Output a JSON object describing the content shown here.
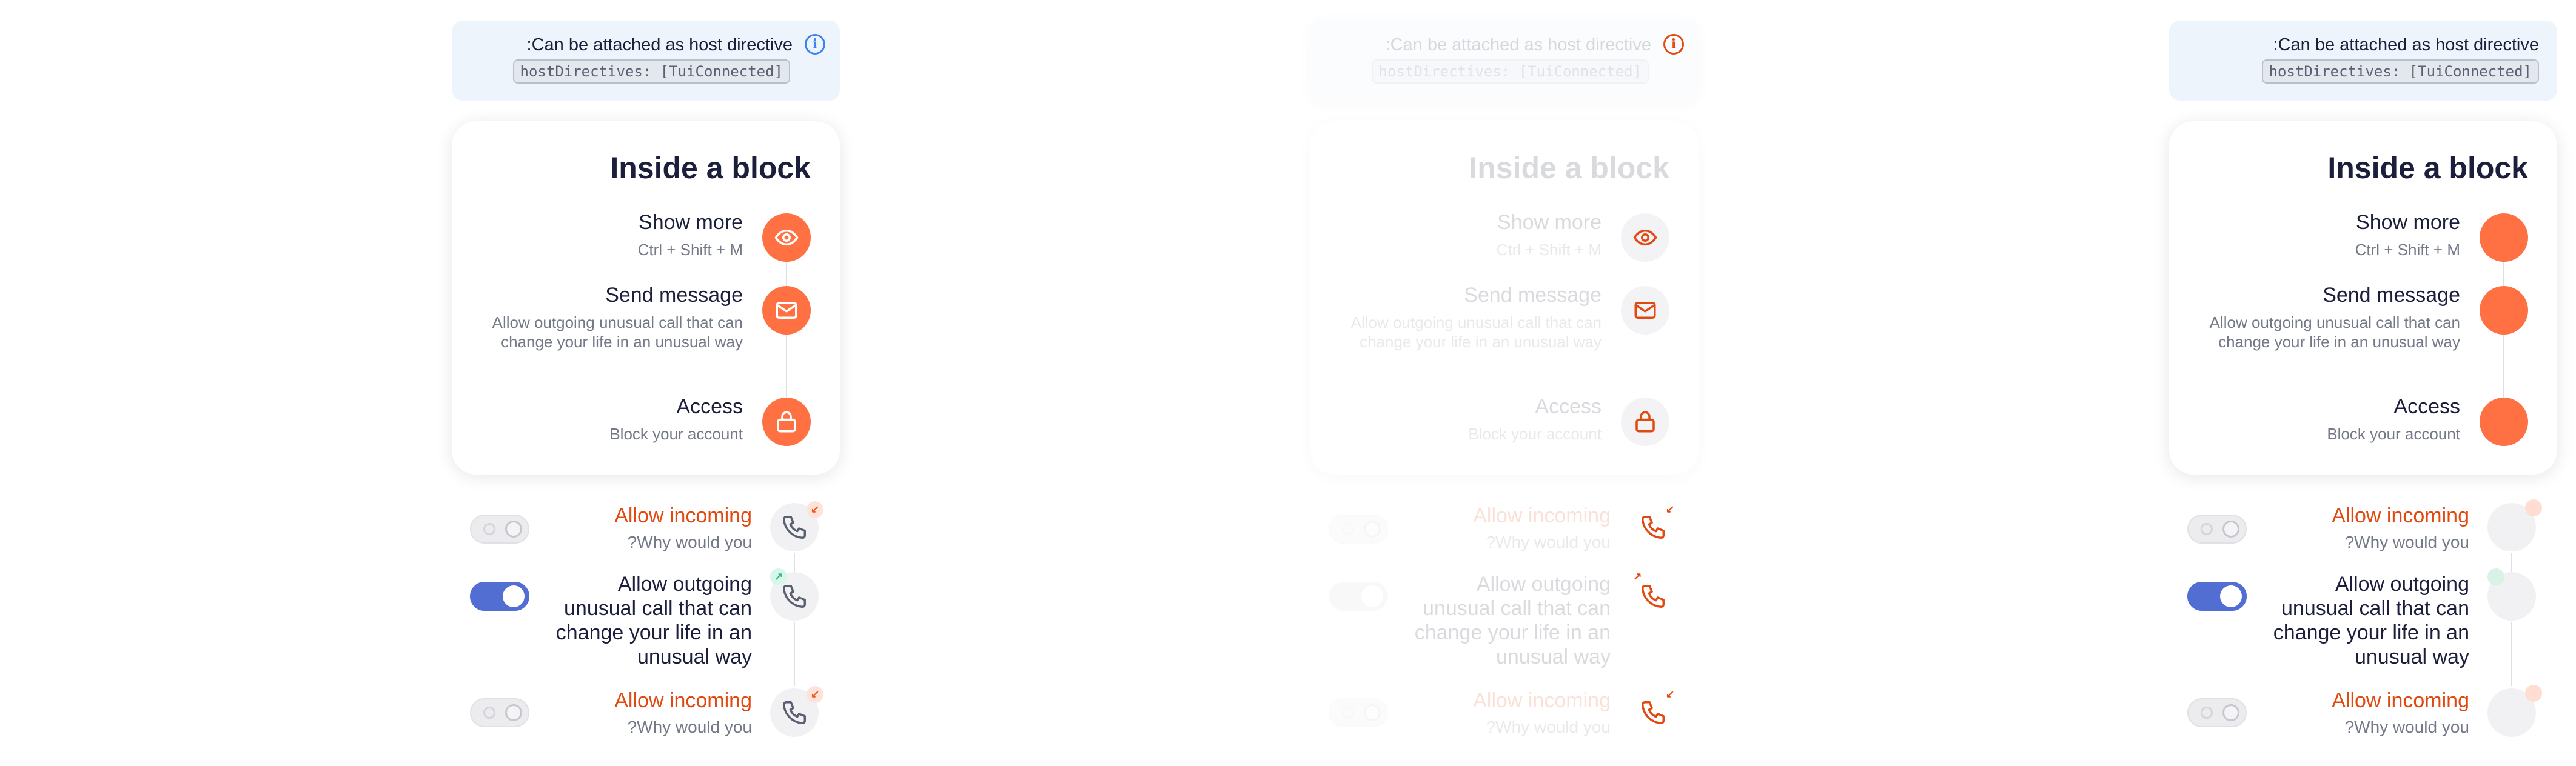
{
  "note": {
    "text": ":Can be attached as host directive",
    "code": "hostDirectives: [TuiConnected]",
    "icon": "info-icon"
  },
  "block": {
    "title": "Inside a block",
    "items": [
      {
        "title": "Show more",
        "desc": "Ctrl + Shift + M",
        "icon": "eye-icon"
      },
      {
        "title": "Send message",
        "desc": "Allow outgoing unusual call that can change your life in an unusual way",
        "icon": "mail-icon"
      },
      {
        "title": "Access",
        "desc": "Block your account",
        "icon": "lock-icon"
      }
    ]
  },
  "calls": [
    {
      "title": "Allow incoming",
      "sub": "?Why would you",
      "toggle_on": false,
      "direction": "incoming",
      "icon": "phone-icon"
    },
    {
      "title": "Allow outgoing unusual call that can change your life in an unusual way",
      "sub": "",
      "toggle_on": true,
      "direction": "outgoing",
      "icon": "phone-icon"
    },
    {
      "title": "Allow incoming",
      "sub": "?Why would you",
      "toggle_on": false,
      "direction": "incoming",
      "icon": "phone-icon"
    }
  ],
  "colors": {
    "accent": "#ff7043",
    "accent_text": "#e0490f",
    "toggle_on": "#526ed3",
    "note_bg": "#eef4fb",
    "info_blue": "#3b82f6"
  }
}
